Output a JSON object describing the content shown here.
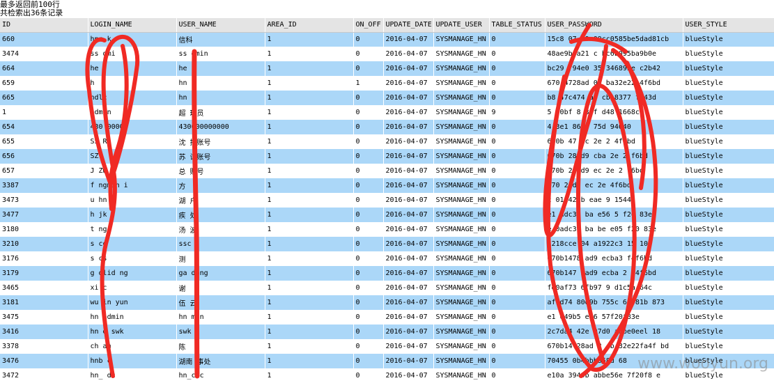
{
  "info": {
    "line1": "最多返回前100行",
    "line2": "共检索出36条记录"
  },
  "columns": [
    "ID",
    "LOGIN_NAME",
    "USER_NAME",
    "AREA_ID",
    "ON_OFF",
    "UPDATE_DATE",
    "UPDATE_USER",
    "TABLE_STATUS",
    "USER_PASSWORD",
    "USER_STYLE"
  ],
  "rows": [
    [
      "660",
      "hnc k",
      "信科",
      "1",
      "0",
      "2016-04-07",
      "SYSMANAGE_HN",
      "0",
      "15c8 07 a9 09cc0585be5dad81cb",
      "blueStyle"
    ],
    [
      "3474",
      "ss dmi",
      "ss dmin",
      "1",
      "0",
      "2016-04-07",
      "SYSMANAGE_HN",
      "0",
      "48ae9b a21 c bc6b095ba9b0e",
      "blueStyle"
    ],
    [
      "664",
      "he",
      "he",
      "1",
      "0",
      "2016-04-07",
      "SYSMANAGE_HN",
      "0",
      "bc29 f94e0 35 346892e c2b42",
      "blueStyle"
    ],
    [
      "659",
      "h",
      "hn",
      "1",
      "1",
      "2016-04-07",
      "SYSMANAGE_HN",
      "0",
      "670 4728ad 02 ba32e22 4f6bd",
      "blueStyle"
    ],
    [
      "665",
      "ndlc",
      "hn c",
      "1",
      "0",
      "2016-04-07",
      "SYSMANAGE_HN",
      "0",
      "b8 47c474 a8 cb 8377 f443d",
      "blueStyle"
    ],
    [
      "1",
      "admin",
      "超 理员",
      "1",
      "0",
      "2016-04-07",
      "SYSMANAGE_HN",
      "9",
      "5 f0bf 8 3 f d48 1668c",
      "blueStyle"
    ],
    [
      "654",
      "430 00000",
      "430000000000",
      "1",
      "0",
      "2016-04-07",
      "SYSMANAGE_HN",
      "0",
      "4 3e1 86 3 75d 94040",
      "blueStyle"
    ],
    [
      "655",
      "SS R",
      "沈 护账号",
      "1",
      "0",
      "2016-04-07",
      "SYSMANAGE_HN",
      "0",
      "670b 47 ec 2e 2 4f6bd",
      "blueStyle"
    ],
    [
      "656",
      "SZ",
      "苏 试账号",
      "1",
      "0",
      "2016-04-07",
      "SYSMANAGE_HN",
      "0",
      "670b 28 d9 cba 2e 2 f6bd",
      "blueStyle"
    ],
    [
      "657",
      "J ZW",
      "总 账号",
      "1",
      "0",
      "2016-04-07",
      "SYSMANAGE_HN",
      "0",
      "670b 28 d9 ec 2e 2 f6bd",
      "blueStyle"
    ],
    [
      "3387",
      "f ngmin i",
      "方 ",
      "1",
      "0",
      "2016-04-07",
      "SYSMANAGE_HN",
      "0",
      "670 28d9 ec 2e 4f6bd",
      "blueStyle"
    ],
    [
      "3473",
      "u hn",
      "湖 户",
      "1",
      "0",
      "2016-04-07",
      "SYSMANAGE_HN",
      "0",
      "2 01 42db eae 9 1544",
      "blueStyle"
    ],
    [
      "3477",
      "h jk",
      "疾 处",
      "1",
      "0",
      "2016-04-07",
      "SYSMANAGE_HN",
      "0",
      "e1 adc39 ba e56 5 f20 83e",
      "blueStyle"
    ],
    [
      "3180",
      "t ngq",
      "汤 波",
      "1",
      "0",
      "2016-04-07",
      "SYSMANAGE_HN",
      "0",
      "e 0adc39 ba be e05 f20 83e",
      "blueStyle"
    ],
    [
      "3210",
      "s cq",
      "ssc",
      "1",
      "0",
      "2016-04-07",
      "SYSMANAGE_HN",
      "0",
      "1218cce 04 a1922c3 15 105",
      "blueStyle"
    ],
    [
      "3176",
      "s cs",
      "测",
      "1",
      "0",
      "2016-04-07",
      "SYSMANAGE_HN",
      "0",
      "670b1478 ad9 ecba3 f4f6bd",
      "blueStyle"
    ],
    [
      "3179",
      "g olid ng",
      "ga dong",
      "1",
      "0",
      "2016-04-07",
      "SYSMANAGE_HN",
      "0",
      "670b147 3ad9 ecba 2 f4f6bd",
      "blueStyle"
    ],
    [
      "3465",
      "xi c",
      "谢",
      "1",
      "0",
      "2016-04-07",
      "SYSMANAGE_HN",
      "0",
      "fe0af73 6fb97 9 d1c5a 64c",
      "blueStyle"
    ],
    [
      "3181",
      "wu in yun",
      "伍 云",
      "1",
      "0",
      "2016-04-07",
      "SYSMANAGE_HN",
      "0",
      "af9d74 80d9b 755c 60981b 873",
      "blueStyle"
    ],
    [
      "3475",
      "hn admin",
      "hn min",
      "1",
      "0",
      "2016-04-07",
      "SYSMANAGE_HN",
      "0",
      "e1 049b5 e56 57f20f83e",
      "blueStyle"
    ],
    [
      "3416",
      "hn d swk",
      "swk",
      "1",
      "0",
      "2016-04-07",
      "SYSMANAGE_HN",
      "0",
      "2c7da4 42e 07d0 adbe0eel 18",
      "blueStyle"
    ],
    [
      "3378",
      "ch an",
      "陈",
      "1",
      "0",
      "2016-04-07",
      "SYSMANAGE_HN",
      "0",
      "670b14 28ad 2 cb 32e22fa4f bd",
      "blueStyle"
    ],
    [
      "3476",
      "hnb c",
      "湖南 事处",
      "1",
      "0",
      "2016-04-07",
      "SYSMANAGE_HN",
      "0",
      "70455 0b4bbb368d 68",
      "blueStyle"
    ],
    [
      "3472",
      "hn_ dc",
      "hn_cdc",
      "1",
      "0",
      "2016-04-07",
      "SYSMANAGE_HN",
      "0",
      "e10a 3949b abbe56e 7f20f8 e",
      "blueStyle"
    ]
  ],
  "watermark": "www.wooyun.org",
  "colors": {
    "row_highlight": "#abd7f8",
    "row_plain": "#ffffff",
    "header_bg": "#e4e4e4",
    "scribble": "#f02a24"
  }
}
